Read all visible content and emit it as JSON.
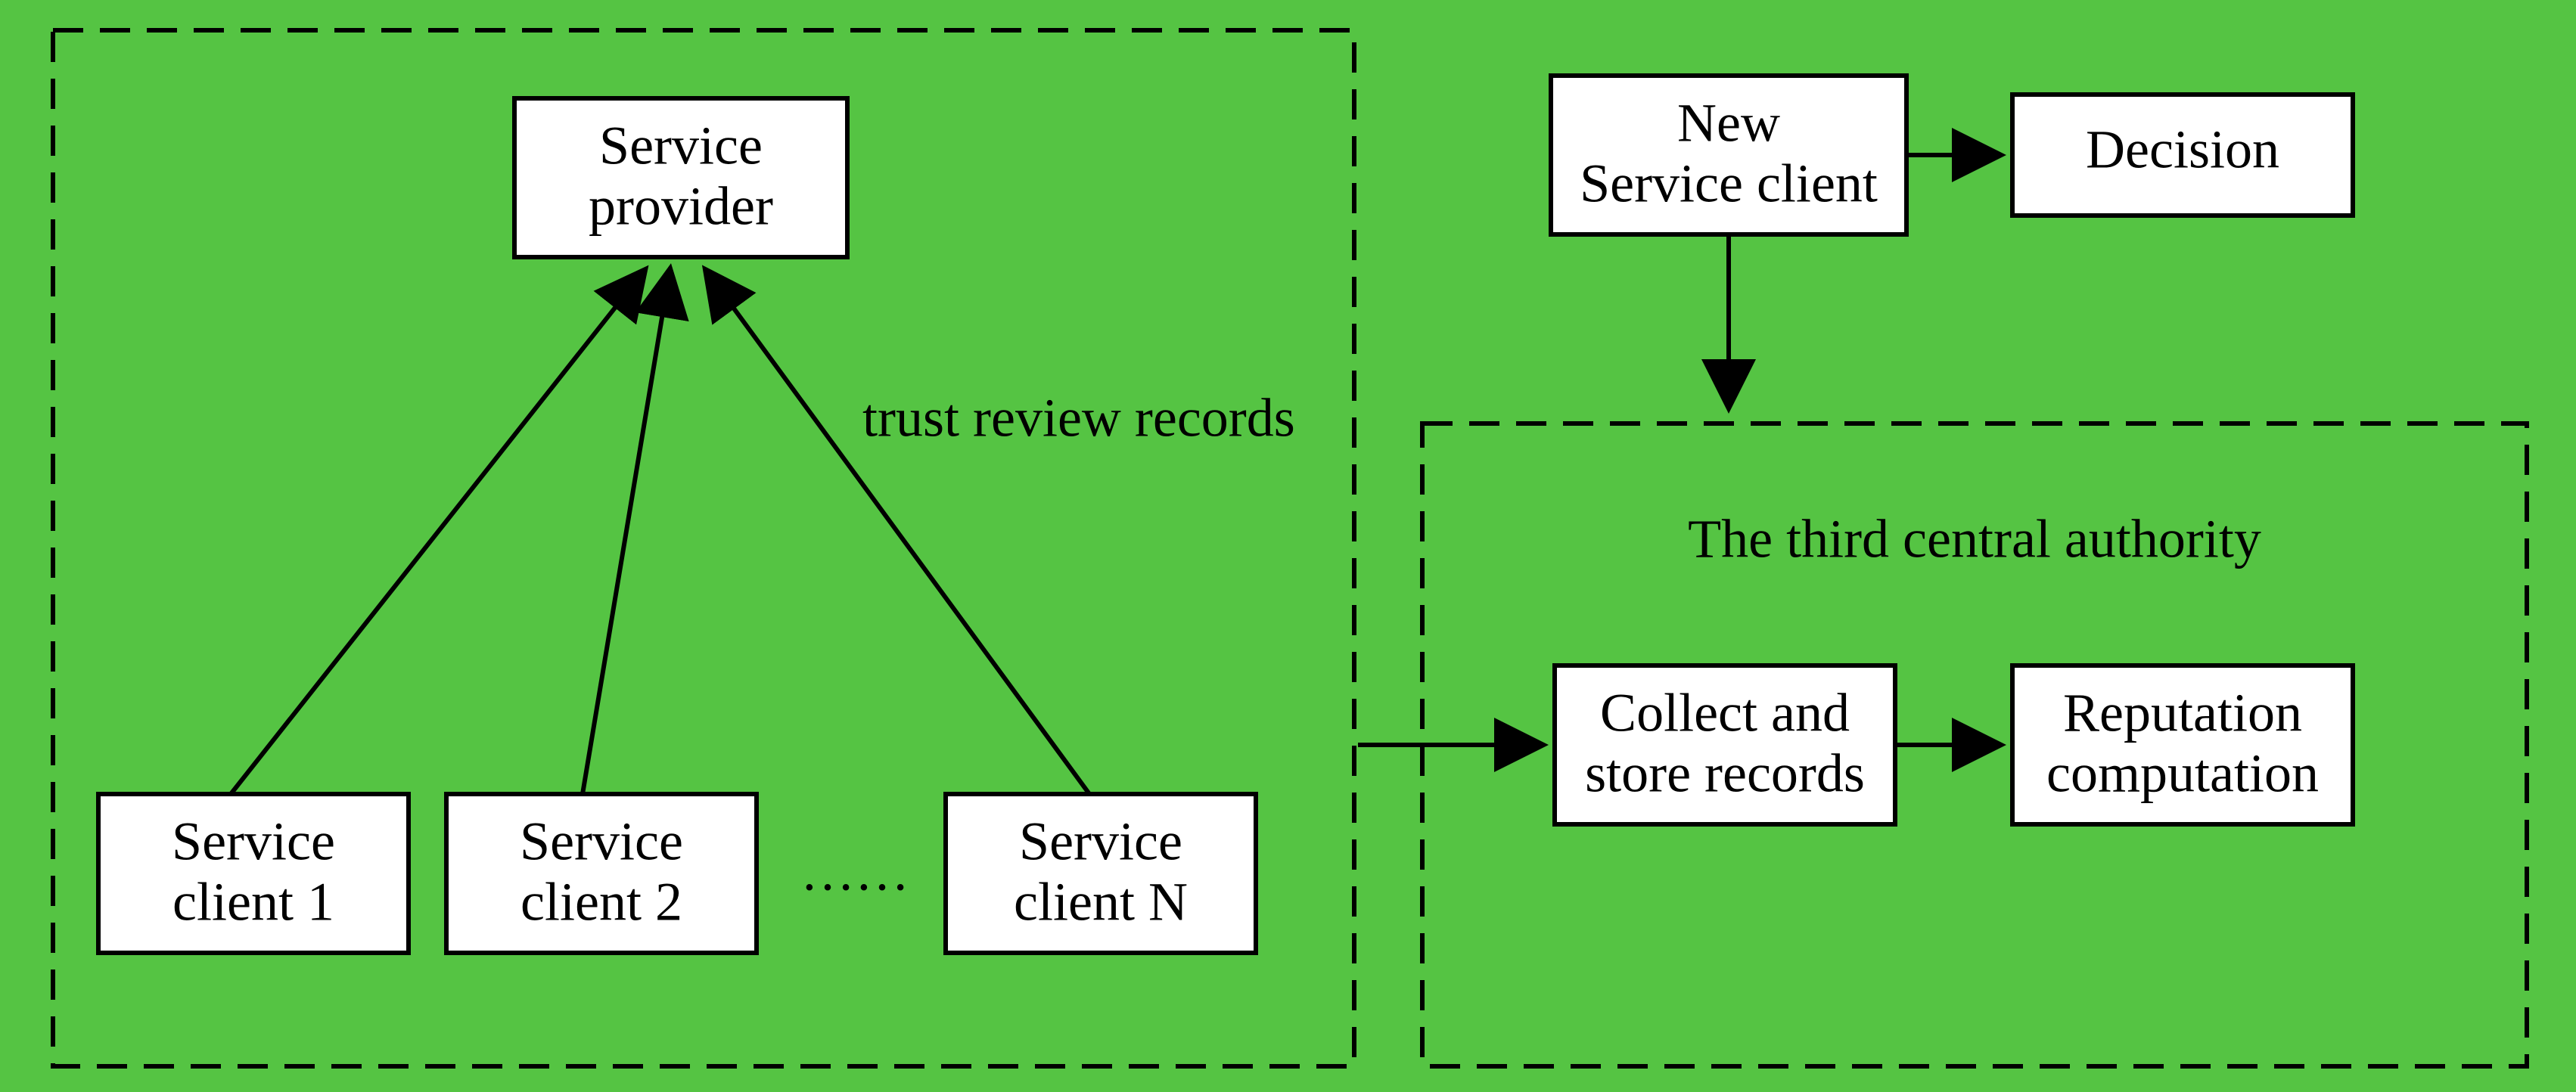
{
  "left_group": {
    "service_provider": "Service\nprovider",
    "trust_review_label": "trust review records",
    "clients": [
      "Service\nclient 1",
      "Service\nclient 2",
      "Service\nclient N"
    ],
    "ellipsis": "……"
  },
  "right": {
    "new_client": "New\nService client",
    "decision": "Decision",
    "authority_title": "The third central authority",
    "collect": "Collect and\nstore records",
    "reputation": "Reputation\ncomputation"
  }
}
